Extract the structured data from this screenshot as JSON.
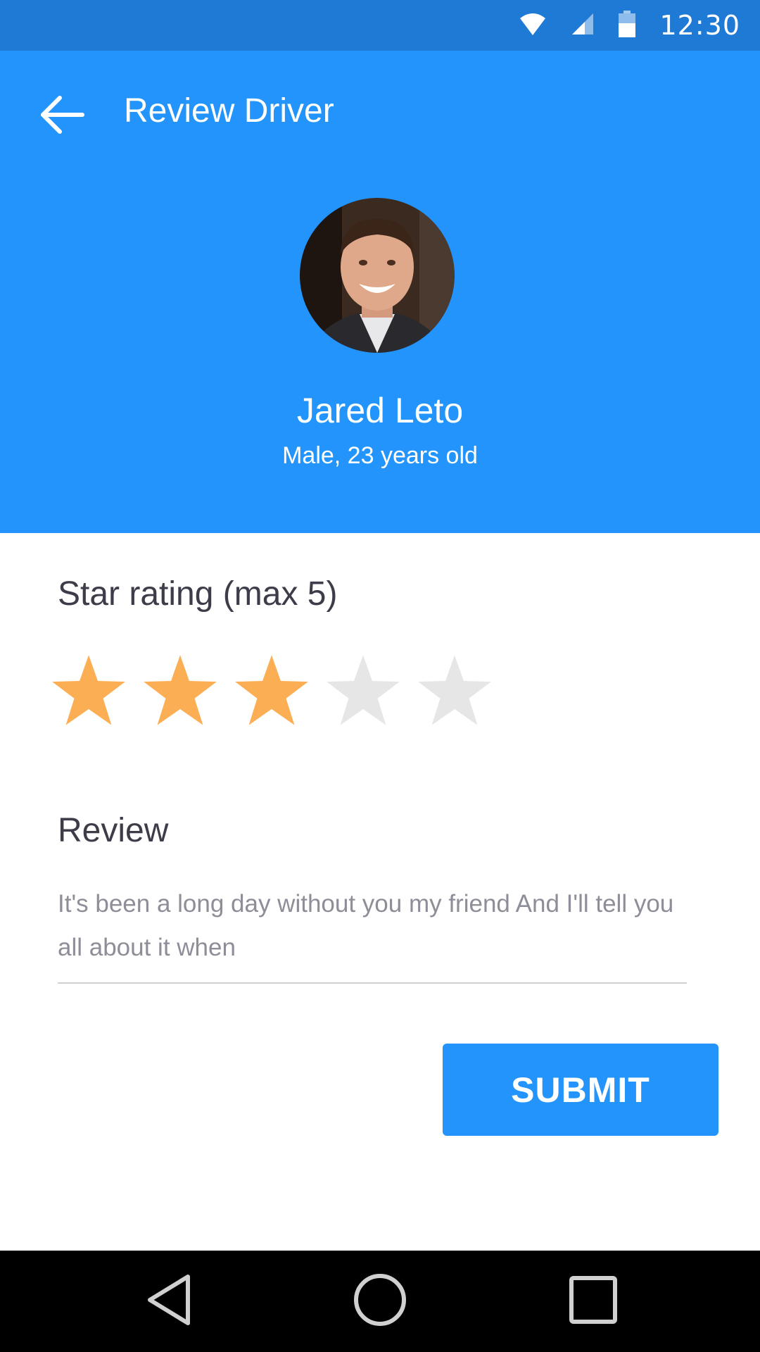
{
  "status_bar": {
    "time": "12:30",
    "icons": [
      "wifi-icon",
      "cell-signal-icon",
      "battery-icon"
    ]
  },
  "header": {
    "title": "Review Driver",
    "back_icon": "arrow-left-icon"
  },
  "driver": {
    "name": "Jared Leto",
    "details": "Male, 23 years old"
  },
  "rating": {
    "label": "Star rating (max 5)",
    "value": 3,
    "max": 5,
    "filled_color": "#fcae55",
    "empty_color": "#e6e6e6"
  },
  "review": {
    "label": "Review",
    "text": "It's been a long day without you my friend And I'll tell you all about it when"
  },
  "submit": {
    "label": "SUBMIT"
  },
  "nav_bar": {
    "icons": [
      "back-triangle-icon",
      "home-circle-icon",
      "recents-square-icon"
    ]
  },
  "colors": {
    "status_bar": "#1f7ad6",
    "primary": "#2394fb"
  }
}
